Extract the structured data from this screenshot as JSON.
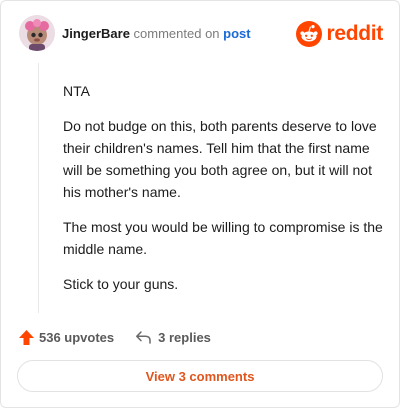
{
  "header": {
    "username": "JingerBare",
    "verb": "commented on",
    "post_link": "post",
    "brand_name": "reddit",
    "brand_color": "#ff4500"
  },
  "comment": {
    "paragraphs": [
      "NTA",
      "Do not budge on this, both parents deserve to love their children's names. Tell him that the first name will be something you both agree on, but it will not his mother's name.",
      "The most you would be willing to compromise is the middle name.",
      "Stick to your guns."
    ]
  },
  "actions": {
    "upvotes_label": "536 upvotes",
    "replies_label": "3 replies",
    "upvote_icon": "upvote-arrow-icon",
    "reply_icon": "reply-arrow-icon"
  },
  "footer": {
    "view_comments_label": "View 3 comments"
  },
  "colors": {
    "accent": "#ff4500",
    "link": "#1a6ad6",
    "muted": "#7c7c7c",
    "button_text": "#e0561e"
  }
}
